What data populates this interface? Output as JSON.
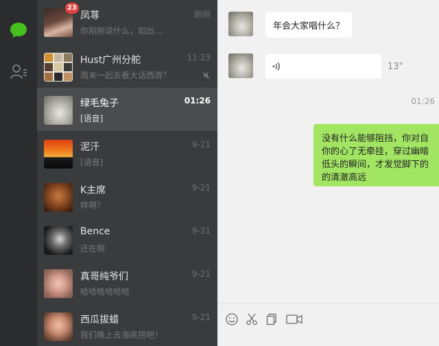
{
  "conversations": [
    {
      "name": "凤荨",
      "preview": "你刚刚说什么，如出...",
      "time": "刚刚",
      "badge": "23"
    },
    {
      "name": "Hust广州分舵",
      "preview": "周末一起去看大话西游？",
      "time": "11:23"
    },
    {
      "name": "绿毛兔子",
      "preview": "[语音]",
      "time": "01:26"
    },
    {
      "name": "泥汗",
      "preview": "[语音]",
      "time": "9-21"
    },
    {
      "name": "K主席",
      "preview": "咩啊？",
      "time": "9-21"
    },
    {
      "name": "Bence",
      "preview": "还在啊",
      "time": "9-21"
    },
    {
      "name": "真哥纯爷们",
      "preview": "哈哈哈哈哈哈",
      "time": "9-21"
    },
    {
      "name": "西瓜拔蜡",
      "preview": "我们晚上去海底捞吧！",
      "time": "9-21"
    }
  ],
  "chat": {
    "messages": {
      "m1": "年会大家唱什么？",
      "voice_duration": "13\"",
      "timestamp": "01:26",
      "out_lines": [
        "没有什么能够阻挡，你对自",
        "你的心了无牵挂，穿过幽暗",
        "低头的瞬间，才发觉脚下的",
        "的清澈高远"
      ]
    }
  },
  "colors": {
    "sidebar": "#2b2c2e",
    "list": "#3a3b3d",
    "active": "#4b4c4e",
    "badge": "#e64340",
    "out_bubble": "#a2e563",
    "nav_active": "#46c11b"
  }
}
